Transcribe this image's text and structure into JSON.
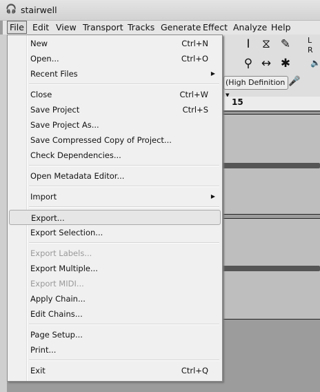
{
  "window": {
    "title": "stairwell",
    "icon": "headphones-icon"
  },
  "menubar": [
    "File",
    "Edit",
    "View",
    "Transport",
    "Tracks",
    "Generate",
    "Effect",
    "Analyze",
    "Help"
  ],
  "toolbar": {
    "device_select": "(High Definition",
    "meter_l": "L",
    "meter_r": "R"
  },
  "ruler": {
    "label": "15"
  },
  "file_menu": [
    {
      "label": "New",
      "shortcut": "Ctrl+N"
    },
    {
      "label": "Open...",
      "shortcut": "Ctrl+O"
    },
    {
      "label": "Recent Files",
      "submenu": true
    },
    {
      "sep": true
    },
    {
      "label": "Close",
      "shortcut": "Ctrl+W"
    },
    {
      "label": "Save Project",
      "shortcut": "Ctrl+S"
    },
    {
      "label": "Save Project As..."
    },
    {
      "label": "Save Compressed Copy of Project..."
    },
    {
      "label": "Check Dependencies..."
    },
    {
      "sep": true
    },
    {
      "label": "Open Metadata Editor..."
    },
    {
      "sep": true
    },
    {
      "label": "Import",
      "submenu": true
    },
    {
      "sep": true
    },
    {
      "label": "Export...",
      "highlighted": true
    },
    {
      "label": "Export Selection..."
    },
    {
      "sep": true
    },
    {
      "label": "Export Labels...",
      "disabled": true
    },
    {
      "label": "Export Multiple..."
    },
    {
      "label": "Export MIDI...",
      "disabled": true
    },
    {
      "label": "Apply Chain..."
    },
    {
      "label": "Edit Chains..."
    },
    {
      "sep": true
    },
    {
      "label": "Page Setup..."
    },
    {
      "label": "Print..."
    },
    {
      "sep": true
    },
    {
      "label": "Exit",
      "shortcut": "Ctrl+Q"
    }
  ]
}
